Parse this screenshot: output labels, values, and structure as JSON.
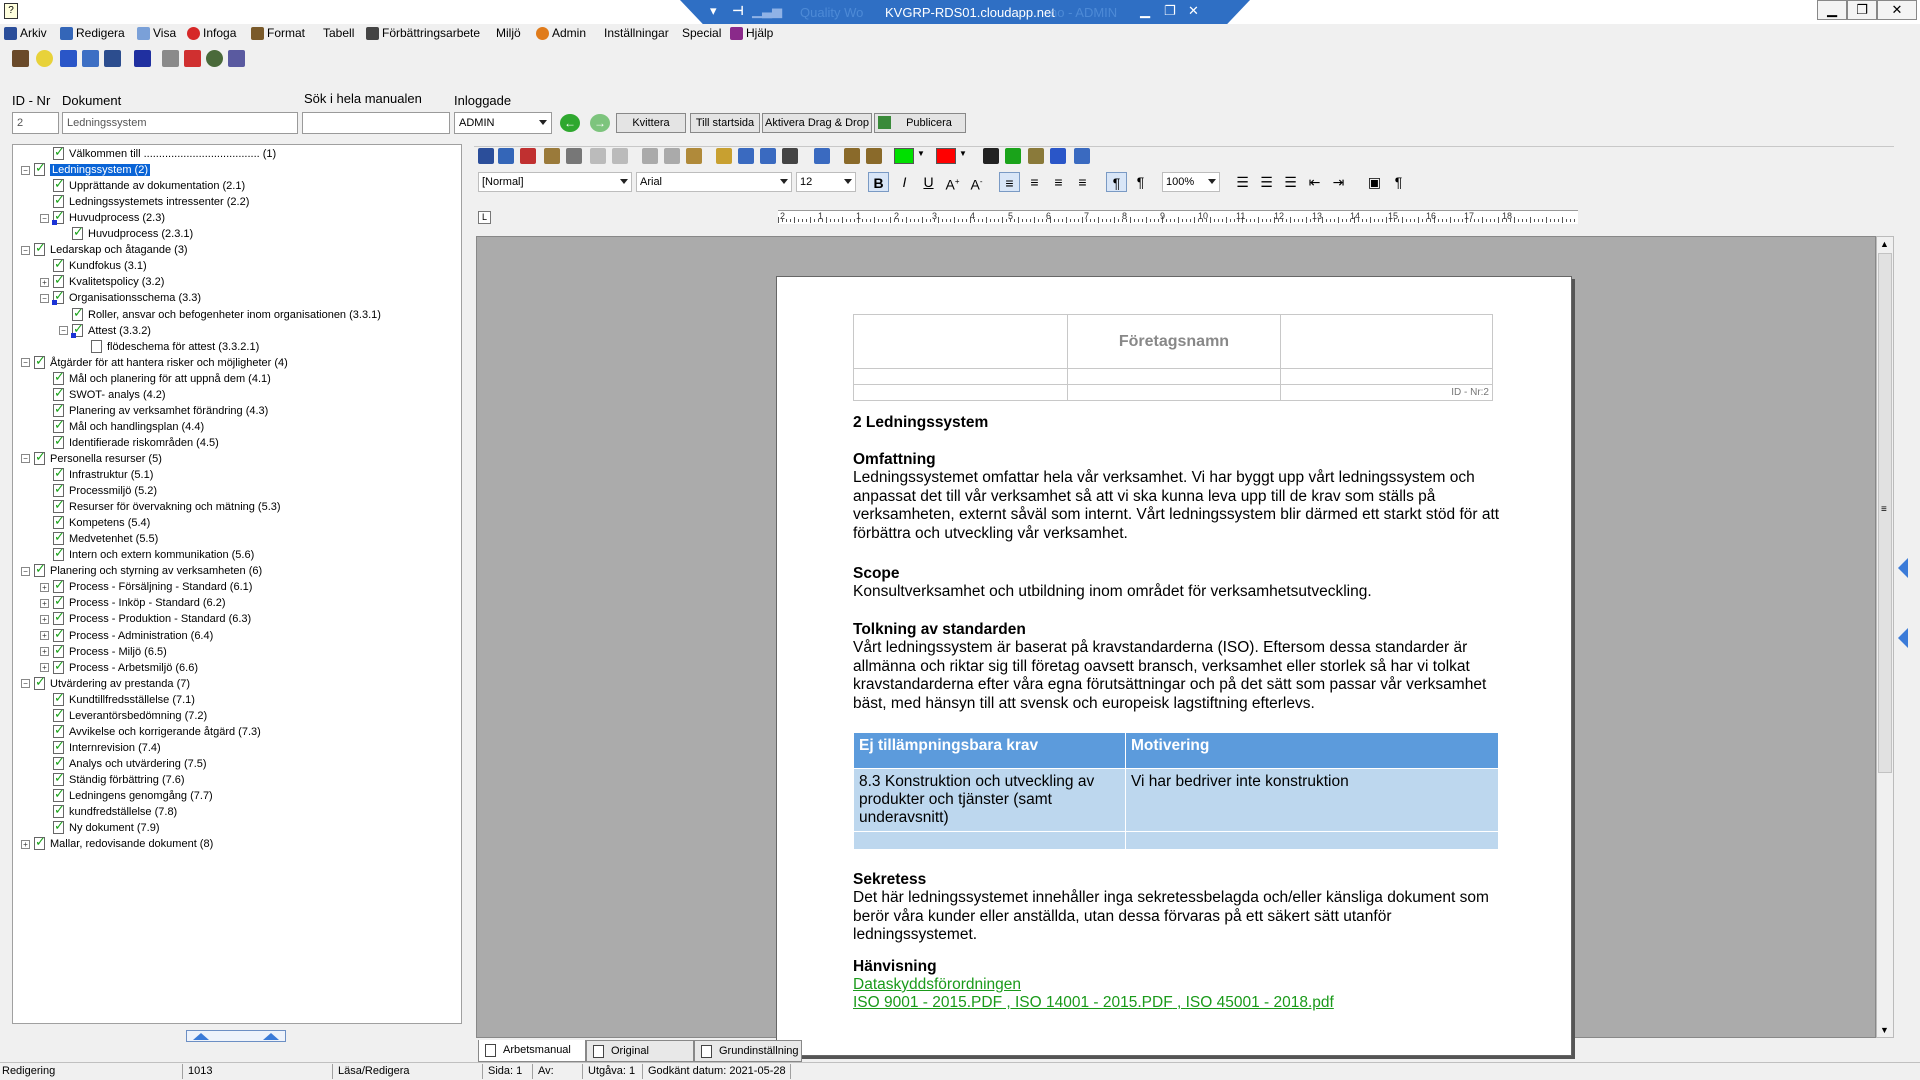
{
  "remote_session": {
    "host": "KVGRP-RDS01.cloudapp.net",
    "ghost_title": "Quality Wo",
    "ghost_title_right": "no - ADMIN"
  },
  "menu": [
    {
      "label": "Arkiv",
      "icon": "save-icon"
    },
    {
      "label": "Redigera",
      "icon": "edit-icon"
    },
    {
      "label": "Visa",
      "icon": "view-icon"
    },
    {
      "label": "Infoga",
      "icon": "insert-icon"
    },
    {
      "label": "Format",
      "icon": "format-icon"
    },
    {
      "label": "Tabell",
      "icon": ""
    },
    {
      "label": "Förbättringsarbete",
      "icon": "improvement-icon"
    },
    {
      "label": "Miljö",
      "icon": ""
    },
    {
      "label": "Admin",
      "icon": "admin-icon"
    },
    {
      "label": "Inställningar",
      "icon": ""
    },
    {
      "label": "Special",
      "icon": ""
    },
    {
      "label": "Hjälp",
      "icon": "help-icon"
    }
  ],
  "header": {
    "id_label": "ID - Nr",
    "doc_label": "Dokument",
    "search_label": "Sök i hela manualen",
    "logged_label": "Inloggade",
    "id_value": "2",
    "doc_value": "Ledningssystem",
    "search_value": "",
    "logged_value": "ADMIN",
    "btn_kvittera": "Kvittera",
    "btn_startsida": "Till startsida",
    "btn_dragdrop": "Aktivera Drag & Drop",
    "btn_publicera": "Publicera"
  },
  "tree": [
    {
      "level": 1,
      "label": "Välkommen till ...................................... (1)",
      "expander": "",
      "selected": false
    },
    {
      "level": 0,
      "label": "Ledningssystem (2)",
      "expander": "-",
      "selected": true
    },
    {
      "level": 1,
      "label": "Upprättande av dokumentation (2.1)",
      "expander": "",
      "selected": false
    },
    {
      "level": 1,
      "label": "Ledningssystemets intressenter (2.2)",
      "expander": "",
      "selected": false
    },
    {
      "level": 1,
      "label": "Huvudprocess (2.3)",
      "expander": "-",
      "selected": false
    },
    {
      "level": 2,
      "label": "Huvudprocess (2.3.1)",
      "expander": "",
      "selected": false
    },
    {
      "level": 0,
      "label": "Ledarskap och åtagande (3)",
      "expander": "-",
      "selected": false
    },
    {
      "level": 1,
      "label": "Kundfokus (3.1)",
      "expander": "",
      "selected": false
    },
    {
      "level": 1,
      "label": "Kvalitetspolicy (3.2)",
      "expander": "+",
      "selected": false
    },
    {
      "level": 1,
      "label": "Organisationsschema (3.3)",
      "expander": "-",
      "selected": false
    },
    {
      "level": 2,
      "label": "Roller, ansvar och befogenheter inom organisationen (3.3.1)",
      "expander": "",
      "selected": false
    },
    {
      "level": 2,
      "label": "Attest (3.3.2)",
      "expander": "-",
      "selected": false
    },
    {
      "level": 3,
      "label": "flödeschema för attest (3.3.2.1)",
      "expander": "",
      "selected": false
    },
    {
      "level": 0,
      "label": "Åtgärder för att hantera risker och möjligheter (4)",
      "expander": "-",
      "selected": false
    },
    {
      "level": 1,
      "label": "Mål och planering för att uppnå dem (4.1)",
      "expander": "",
      "selected": false
    },
    {
      "level": 1,
      "label": "SWOT- analys (4.2)",
      "expander": "",
      "selected": false
    },
    {
      "level": 1,
      "label": "Planering av verksamhet förändring (4.3)",
      "expander": "",
      "selected": false
    },
    {
      "level": 1,
      "label": "Mål och handlingsplan (4.4)",
      "expander": "",
      "selected": false
    },
    {
      "level": 1,
      "label": "Identifierade riskområden (4.5)",
      "expander": "",
      "selected": false
    },
    {
      "level": 0,
      "label": "Personella resurser (5)",
      "expander": "-",
      "selected": false
    },
    {
      "level": 1,
      "label": "Infrastruktur (5.1)",
      "expander": "",
      "selected": false
    },
    {
      "level": 1,
      "label": "Processmiljö (5.2)",
      "expander": "",
      "selected": false
    },
    {
      "level": 1,
      "label": "Resurser för övervakning och mätning (5.3)",
      "expander": "",
      "selected": false
    },
    {
      "level": 1,
      "label": "Kompetens (5.4)",
      "expander": "",
      "selected": false
    },
    {
      "level": 1,
      "label": "Medvetenhet (5.5)",
      "expander": "",
      "selected": false
    },
    {
      "level": 1,
      "label": "Intern och extern kommunikation (5.6)",
      "expander": "",
      "selected": false
    },
    {
      "level": 0,
      "label": "Planering och styrning av verksamheten (6)",
      "expander": "-",
      "selected": false
    },
    {
      "level": 1,
      "label": "Process - Försäljning - Standard (6.1)",
      "expander": "+",
      "selected": false
    },
    {
      "level": 1,
      "label": "Process - Inköp - Standard (6.2)",
      "expander": "+",
      "selected": false
    },
    {
      "level": 1,
      "label": "Process - Produktion - Standard (6.3)",
      "expander": "+",
      "selected": false
    },
    {
      "level": 1,
      "label": "Process - Administration (6.4)",
      "expander": "+",
      "selected": false
    },
    {
      "level": 1,
      "label": "Process - Miljö (6.5)",
      "expander": "+",
      "selected": false
    },
    {
      "level": 1,
      "label": "Process - Arbetsmiljö (6.6)",
      "expander": "+",
      "selected": false
    },
    {
      "level": 0,
      "label": "Utvärdering av prestanda (7)",
      "expander": "-",
      "selected": false
    },
    {
      "level": 1,
      "label": "Kundtillfredsställelse (7.1)",
      "expander": "",
      "selected": false
    },
    {
      "level": 1,
      "label": "Leverantörsbedömning (7.2)",
      "expander": "",
      "selected": false
    },
    {
      "level": 1,
      "label": "Avvikelse och korrigerande åtgärd (7.3)",
      "expander": "",
      "selected": false
    },
    {
      "level": 1,
      "label": "Internrevision (7.4)",
      "expander": "",
      "selected": false
    },
    {
      "level": 1,
      "label": "Analys och utvärdering (7.5)",
      "expander": "",
      "selected": false
    },
    {
      "level": 1,
      "label": "Ständig förbättring (7.6)",
      "expander": "",
      "selected": false
    },
    {
      "level": 1,
      "label": "Ledningens genomgång (7.7)",
      "expander": "",
      "selected": false
    },
    {
      "level": 1,
      "label": "kundfredställelse (7.8)",
      "expander": "",
      "selected": false
    },
    {
      "level": 1,
      "label": "Ny dokument (7.9)",
      "expander": "",
      "selected": false
    },
    {
      "level": 0,
      "label": "Mallar, redovisande dokument (8)",
      "expander": "+",
      "selected": false
    }
  ],
  "editor": {
    "style": "[Normal]",
    "font": "Arial",
    "size": "12",
    "zoom": "100%",
    "fill_color": "#00e000",
    "text_color": "#ff0000",
    "ruler_numbers": [
      "2",
      "1",
      "1",
      "2",
      "3",
      "4",
      "5",
      "6",
      "7",
      "8",
      "9",
      "10",
      "11",
      "12",
      "13",
      "14",
      "15",
      "16",
      "17",
      "18"
    ]
  },
  "document": {
    "company": "Företagsnamn",
    "id_nr": "ID - Nr:2",
    "title": "2 Ledningssystem",
    "s1_head": "Omfattning",
    "s1_body": "Ledningssystemet omfattar hela vår verksamhet. Vi har byggt upp vårt ledningssystem och anpassat det till vår verksamhet så att vi ska kunna leva upp till de krav som ställs på verksamheten, externt såväl som internt. Vårt ledningssystem blir därmed ett starkt stöd för att förbättra och utveckling vår verksamhet.",
    "s2_head": "Scope",
    "s2_body": "Konsultverksamhet och utbildning inom området för verksamhetsutveckling.",
    "s3_head": "Tolkning av standarden",
    "s3_body": "Vårt ledningssystem är baserat på kravstandarderna (ISO). Eftersom dessa standarder är allmänna och riktar sig till företag oavsett bransch, verksamhet eller storlek så har vi tolkat kravstandarderna efter våra egna förutsättningar och på det sätt som passar vår verksamhet bäst, med hänsyn till att svensk och europeisk lagstiftning efterlevs.",
    "table_h1": "Ej tillämpningsbara krav",
    "table_h2": "Motivering",
    "table_c1": "8.3 Konstruktion och utveckling av produkter och tjänster (samt underavsnitt)",
    "table_c2": "Vi har bedriver inte konstruktion",
    "s4_head": "Sekretess",
    "s4_body": "Det här ledningssystemet innehåller inga sekretessbelagda och/eller känsliga dokument som berör våra kunder eller anställda, utan dessa förvaras på ett säkert sätt utanför ledningssystemet.",
    "s5_head": "Hänvisning",
    "link1": "Dataskyddsförordningen",
    "link2": "ISO 9001 - 2015.PDF",
    "link3": "ISO 14001 - 2015.PDF",
    "link4": "ISO 45001 - 2018.pdf",
    "link_sep": " , "
  },
  "tabs": [
    {
      "label": "Arbetsmanual",
      "active": true
    },
    {
      "label": "Original",
      "active": false
    },
    {
      "label": "Grundinställning",
      "active": false
    }
  ],
  "status": {
    "mode": "Redigering",
    "number": "1013",
    "access": "Läsa/Redigera",
    "page": "Sida: 1",
    "av": "Av:",
    "edition": "Utgåva: 1",
    "approved": "Godkänt datum: 2021-05-28"
  }
}
